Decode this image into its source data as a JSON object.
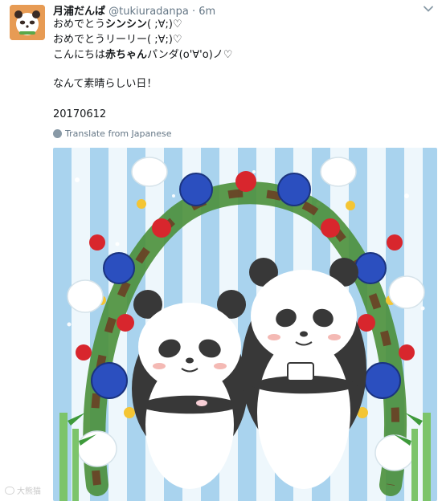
{
  "tweet": {
    "display_name": "月浦だんぱ",
    "handle": "@tukiuradanpa",
    "separator": " · ",
    "time": "6m",
    "lines": [
      {
        "before": "おめでとう",
        "bold": "シンシン",
        "after": "( ;∀;)♡"
      },
      {
        "before": "おめでとうリーリー( ;∀;)♡",
        "bold": "",
        "after": ""
      },
      {
        "before": "こんにちは",
        "bold": "赤ちゃん",
        "after": "パンダ(o'∀'o)ノ♡"
      }
    ],
    "line4": "なんて素晴らしい日！",
    "line5": "20170612",
    "translate_label": "Translate from Japanese",
    "icons": {
      "menu": "chevron-down-icon",
      "translate": "globe-icon"
    }
  },
  "watermark": {
    "text": "大熊猫"
  },
  "colors": {
    "stripe_blue": "#a9d3ee",
    "stripe_white": "#eef7fc",
    "panda_black": "#383838",
    "rose_blue": "#2b4fbf",
    "rose_red": "#d8262d",
    "leaf_green": "#3e9a3b",
    "bamboo": "#7cc46a"
  }
}
